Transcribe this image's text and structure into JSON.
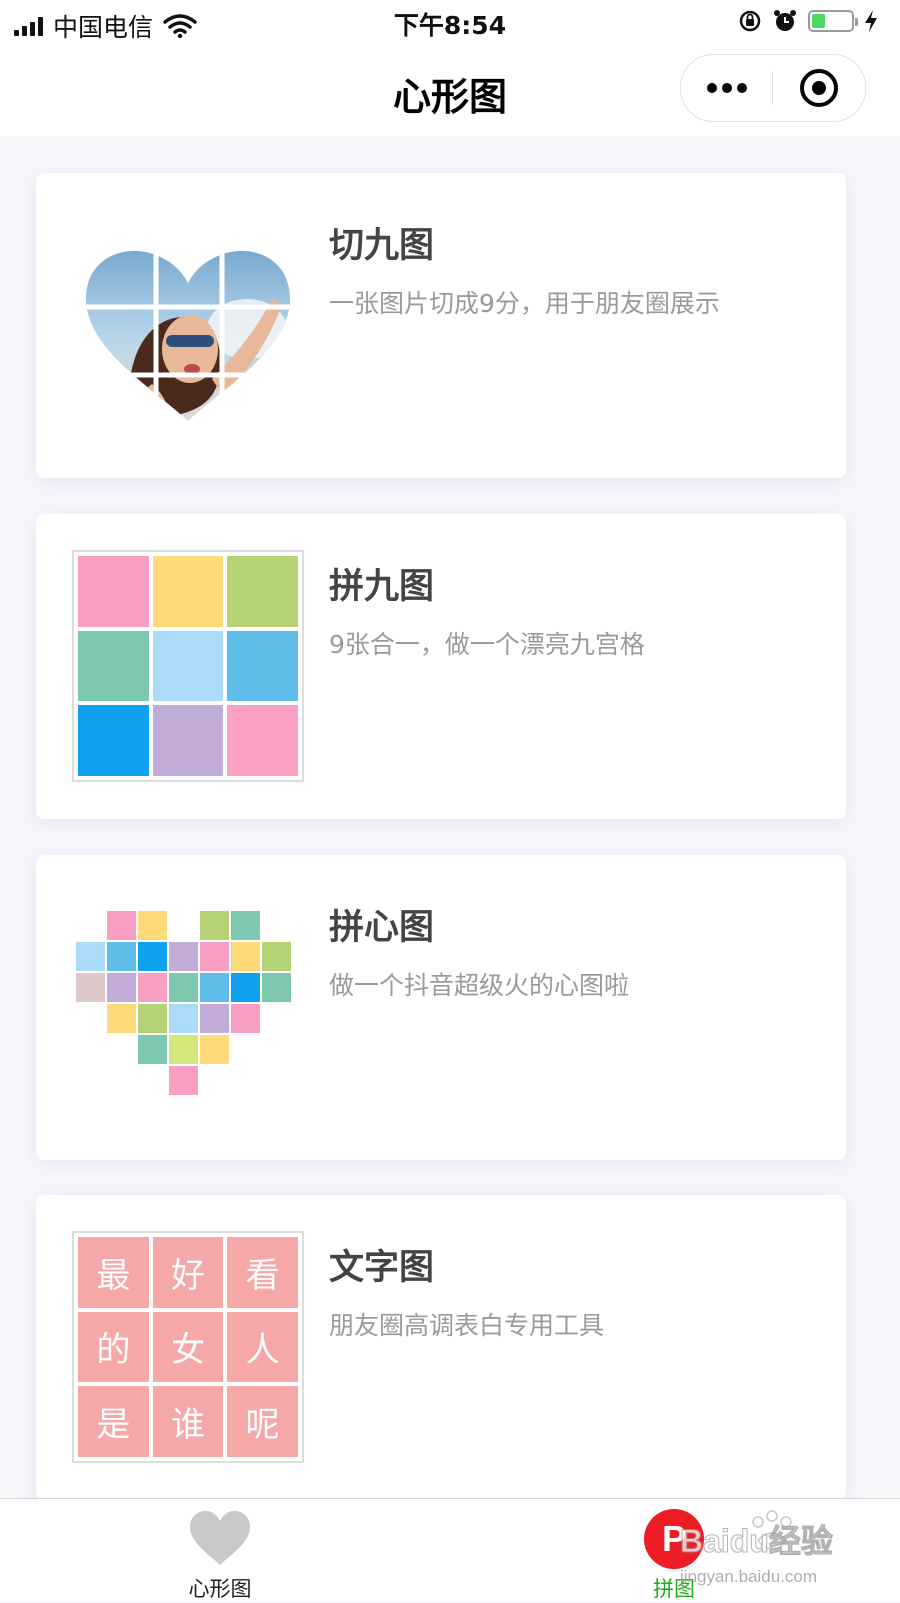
{
  "status_bar": {
    "carrier": "中国电信",
    "time": "下午8:54",
    "battery_level": 0.35,
    "icons": [
      "signal-icon",
      "wifi-icon",
      "orientation-lock-icon",
      "alarm-icon",
      "battery-icon",
      "charging-icon"
    ]
  },
  "nav": {
    "title": "心形图",
    "capsule_icons": [
      "more-icon",
      "close-icon"
    ]
  },
  "cards": [
    {
      "title": "切九图",
      "desc": "一张图片切成9分，用于朋友圈展示",
      "thumb": "heart-photo-grid"
    },
    {
      "title": "拼九图",
      "desc": "9张合一，做一个漂亮九宫格",
      "thumb": "color-nine-grid",
      "colors": [
        "#f99fc3",
        "#fdd977",
        "#b5d277",
        "#7ec8b2",
        "#aadcf9",
        "#5ebde9",
        "#0fa0ef",
        "#c1abd9",
        "#fc9fc5"
      ]
    },
    {
      "title": "拼心图",
      "desc": "做一个抖音超级火的心图啦",
      "thumb": "pixel-heart"
    },
    {
      "title": "文字图",
      "desc": "朋友圈高调表白专用工具",
      "thumb": "text-grid",
      "grid_text": [
        "最",
        "好",
        "看",
        "的",
        "女",
        "人",
        "是",
        "谁",
        "呢"
      ]
    }
  ],
  "tab_bar": {
    "tabs": [
      {
        "label": "心形图",
        "icon": "heart-icon",
        "color": "#222222"
      },
      {
        "label": "拼图",
        "icon": "puzzle-logo-icon",
        "color": "#1aad19"
      }
    ]
  },
  "watermark": {
    "text": "Baidu经验",
    "url_text": "jingyan.baidu.com"
  },
  "colors": {
    "accent_green": "#1aad19",
    "tile_pink": "#f6a8a8",
    "page_bg": "#f6f6fb"
  }
}
